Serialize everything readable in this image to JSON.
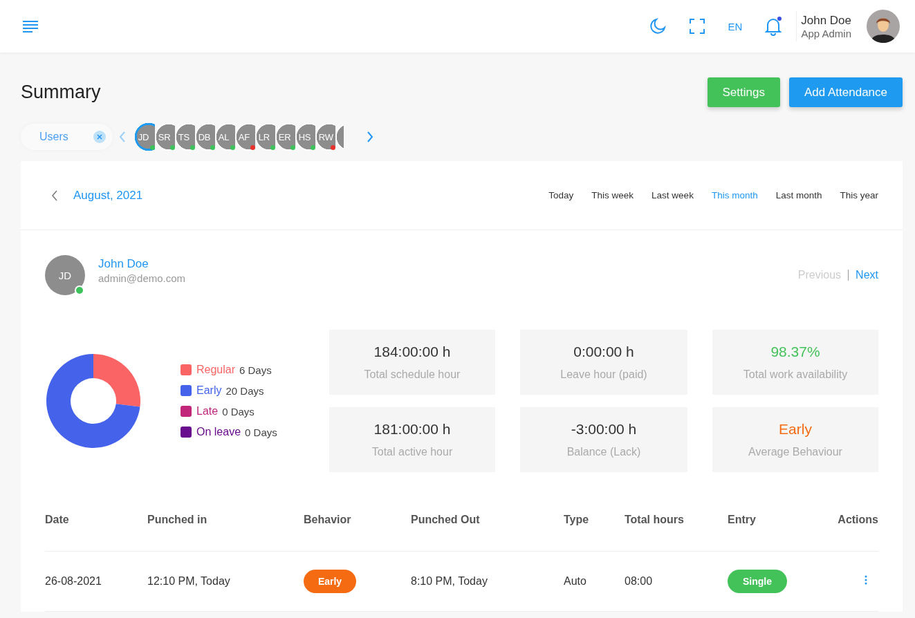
{
  "header": {
    "language": "EN",
    "notification_unread": true,
    "user": {
      "name": "John Doe",
      "role": "App Admin"
    }
  },
  "page": {
    "title": "Summary",
    "buttons": [
      {
        "label": "Settings",
        "kind": "secondary"
      },
      {
        "label": "Add Attendance",
        "kind": "primary"
      }
    ]
  },
  "user_filter": {
    "label": "Users"
  },
  "users": [
    {
      "initials": "JD",
      "color": "#3ec25c",
      "selected": true
    },
    {
      "initials": "SR",
      "color": "#3ec25c",
      "selected": false
    },
    {
      "initials": "TS",
      "color": "#3ec25c",
      "selected": false
    },
    {
      "initials": "DB",
      "color": "#3ec25c",
      "selected": false
    },
    {
      "initials": "AL",
      "color": "#3ec25c",
      "selected": false
    },
    {
      "initials": "AF",
      "color": "#e8322b",
      "selected": false
    },
    {
      "initials": "LR",
      "color": "#3ec25c",
      "selected": false
    },
    {
      "initials": "ER",
      "color": "#3ec25c",
      "selected": false
    },
    {
      "initials": "HS",
      "color": "#3ec25c",
      "selected": false
    },
    {
      "initials": "RW",
      "color": "#e8322b",
      "selected": false
    }
  ],
  "period": {
    "month": "August, 2021",
    "tabs": [
      {
        "label": "Today",
        "selected": false
      },
      {
        "label": "This week",
        "selected": false
      },
      {
        "label": "Last week",
        "selected": false
      },
      {
        "label": "This month",
        "selected": true
      },
      {
        "label": "Last month",
        "selected": false
      },
      {
        "label": "This year",
        "selected": false
      }
    ]
  },
  "profile": {
    "initials": "JD",
    "name": "John Doe",
    "email": "admin@demo.com",
    "online": true,
    "previous": "Previous",
    "next": "Next"
  },
  "chart_data": {
    "type": "donut",
    "categories": [
      "Regular",
      "Early",
      "Late",
      "On leave"
    ],
    "values": [
      27,
      73,
      0,
      0
    ]
  },
  "legend": [
    {
      "value": "6 Days",
      "color": "#fa6464"
    },
    {
      "value": "20 Days",
      "color": "#4462ea"
    },
    {
      "value": "0 Days",
      "color": "#c1267a"
    },
    {
      "value": "0 Days",
      "color": "#6a0c8e"
    }
  ],
  "stats": [
    {
      "value": "184:00:00 h",
      "label": "Total schedule hour",
      "kind": "plain"
    },
    {
      "value": "0:00:00 h",
      "label": "Leave hour (paid)",
      "kind": "plain"
    },
    {
      "value": "98.37%",
      "label": "Total work availability",
      "kind": "good"
    },
    {
      "value": "181:00:00 h",
      "label": "Total active hour",
      "kind": "plain"
    },
    {
      "value": "-3:00:00 h",
      "label": "Balance (Lack)",
      "kind": "plain"
    },
    {
      "value": "Early",
      "label": "Average Behaviour",
      "kind": "warn"
    }
  ],
  "table": {
    "columns": [
      "Date",
      "Punched in",
      "Behavior",
      "Punched Out",
      "Type",
      "Total hours",
      "Entry",
      "Actions"
    ],
    "rows": [
      {
        "date": "26-08-2021",
        "punched_in": "12:10 PM, Today",
        "behavior": "Early",
        "punched_out": "8:10 PM, Today",
        "type": "Auto",
        "total_hours": "08:00",
        "entry": "Single"
      }
    ]
  }
}
